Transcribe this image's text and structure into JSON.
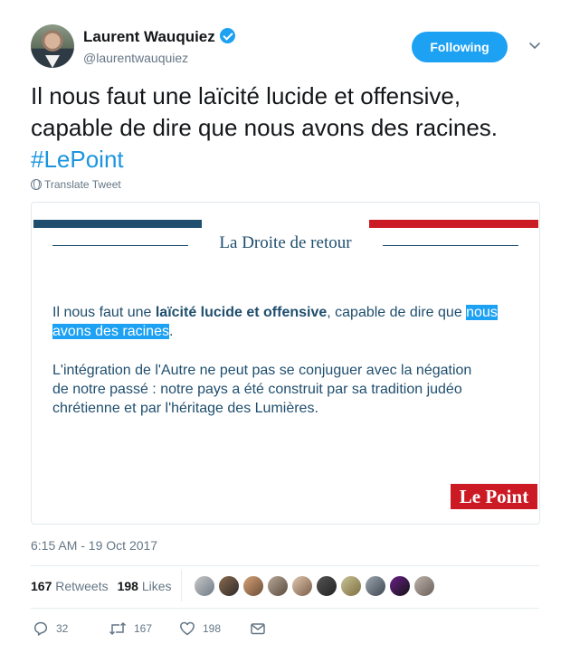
{
  "user": {
    "name": "Laurent Wauquiez",
    "handle": "@laurentwauquiez",
    "follow_label": "Following"
  },
  "tweet": {
    "text_line1": "Il nous faut une laïcité lucide et offensive,",
    "text_line2": "capable de dire que nous avons des racines.",
    "hashtag": "#LePoint",
    "translate_label": "Translate Tweet",
    "timestamp": "6:15 AM - 19 Oct 2017"
  },
  "media": {
    "section_title": "La Droite de retour",
    "quote_pre": "Il nous faut une ",
    "quote_bold": "laïcité lucide et offensive",
    "quote_mid": ", capable de dire que ",
    "quote_hl1": "nous",
    "quote_hl2": "avons des racines",
    "quote_end": ".",
    "body_line1": "L'intégration de l'Autre ne peut pas se conjuguer avec la négation",
    "body_line2": "de notre passé : notre pays a été construit par sa tradition judéo",
    "body_line3": "chrétienne et par l'héritage des Lumières.",
    "logo_text": "Le Point"
  },
  "stats": {
    "retweets_count": "167",
    "retweets_label": "Retweets",
    "likes_count": "198",
    "likes_label": "Likes"
  },
  "actions": {
    "reply_count": "32",
    "retweet_count": "167",
    "like_count": "198"
  },
  "icons": {
    "verified": "verified-badge-icon",
    "chevron": "chevron-down-icon",
    "globe": "globe-icon",
    "reply": "reply-icon",
    "retweet": "retweet-icon",
    "like": "heart-icon",
    "dm": "envelope-icon"
  },
  "colors": {
    "accent": "#1da1f2",
    "hashtag": "#1b95e0",
    "lepoint_red": "#cc1a25",
    "lepoint_blue": "#1f4e6e",
    "muted": "#657786"
  }
}
